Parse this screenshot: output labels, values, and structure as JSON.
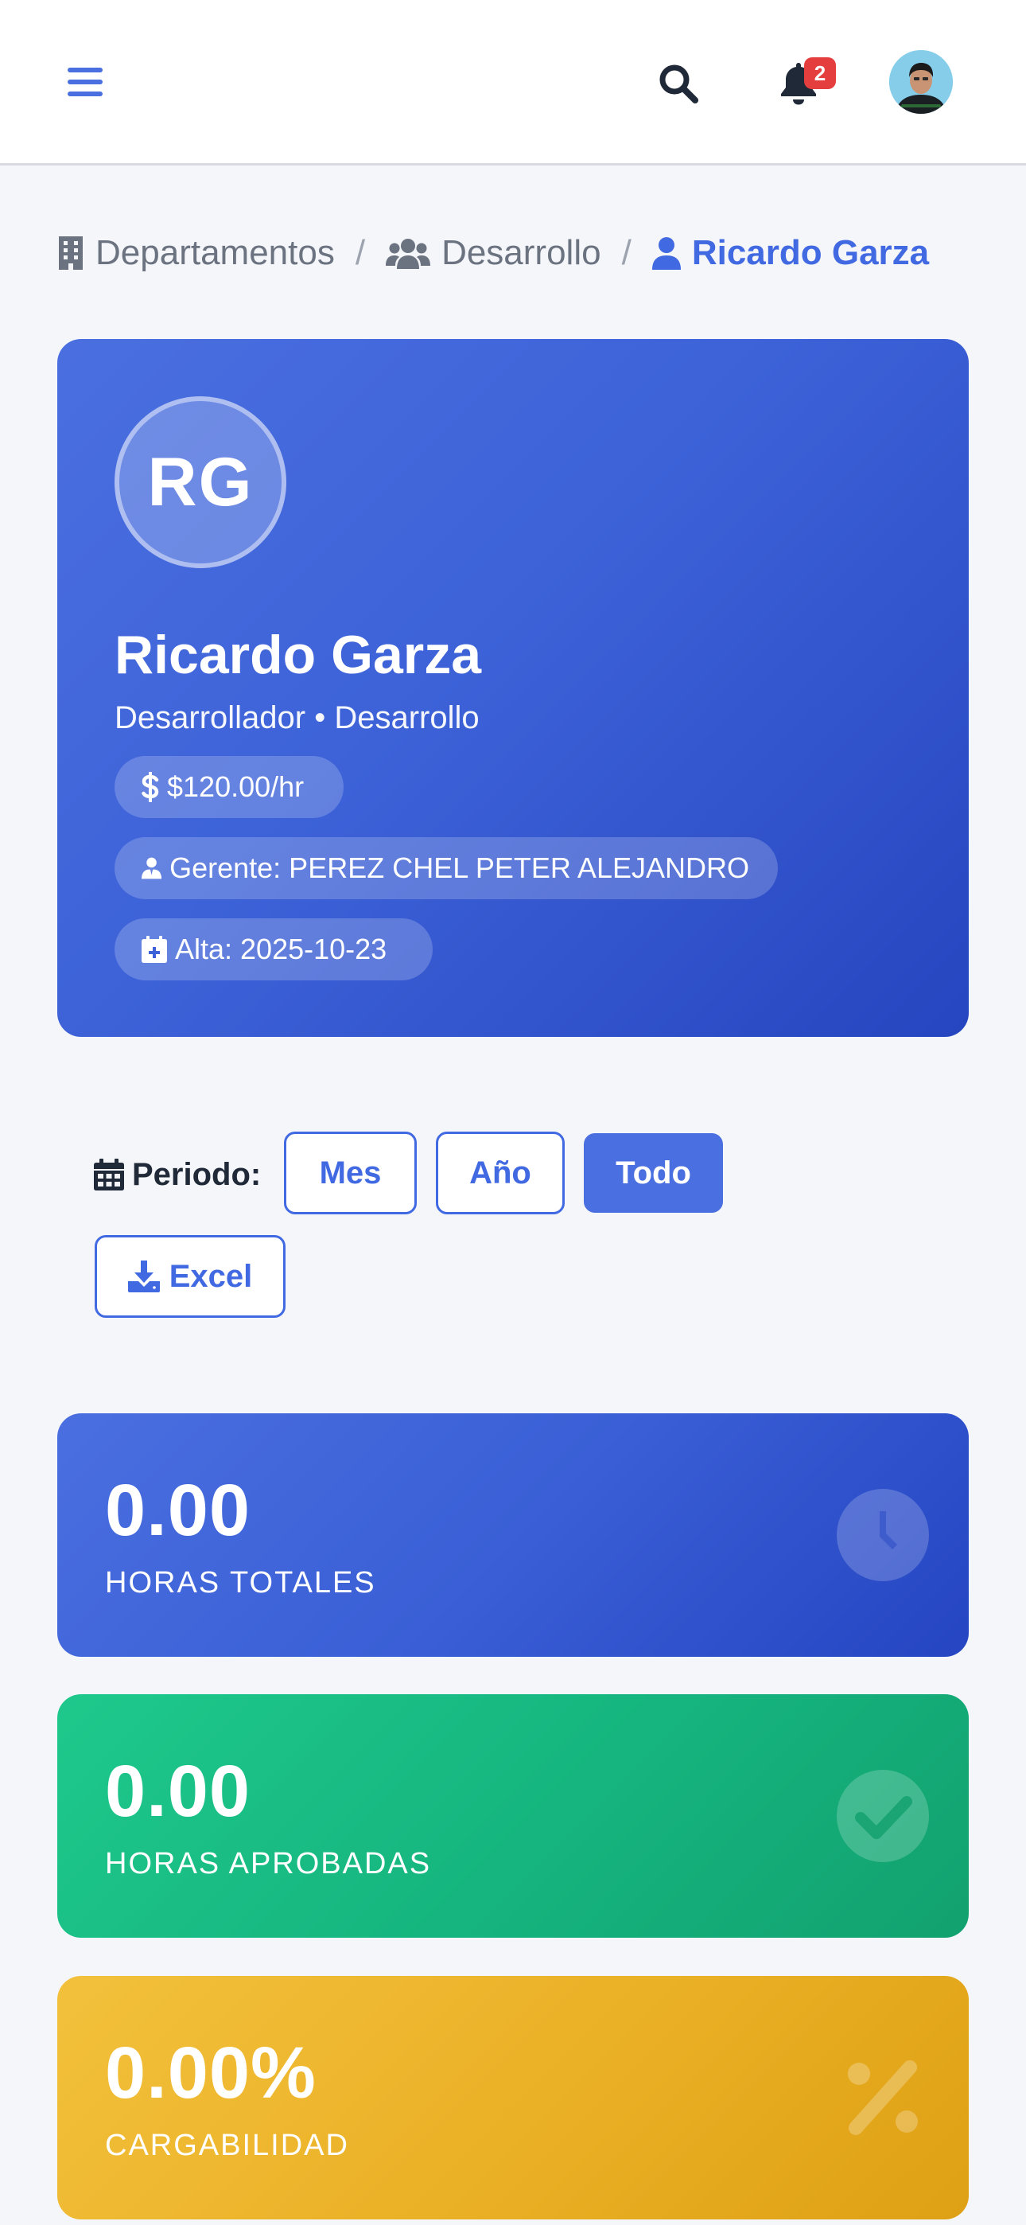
{
  "header": {
    "notifications_count": "2",
    "icons": {
      "menu": "bars-icon",
      "search": "search-icon",
      "notifications": "bell-icon",
      "avatar": "user-avatar"
    }
  },
  "breadcrumb": [
    {
      "label": "Departamentos",
      "icon": "building-icon"
    },
    {
      "label": "Desarrollo",
      "icon": "users-icon"
    },
    {
      "label": "Ricardo Garza",
      "icon": "user-icon"
    }
  ],
  "breadcrumb_separator": "/",
  "profile": {
    "initials": "RG",
    "name": "Ricardo Garza",
    "role_line": "Desarrollador • Desarrollo",
    "rate": "$120.00/hr",
    "manager": "Gerente: PEREZ CHEL PETER ALEJANDRO",
    "hire_date": "Alta: 2025-10-23"
  },
  "period": {
    "label": "Periodo:",
    "options": [
      "Mes",
      "Año",
      "Todo"
    ],
    "selected": "Todo",
    "export_label": "Excel"
  },
  "stats": [
    {
      "value": "0.00",
      "label": "HORAS TOTALES",
      "icon": "clock-icon",
      "color": "#4a6fe0"
    },
    {
      "value": "0.00",
      "label": "HORAS APROBADAS",
      "icon": "check-circle-icon",
      "color": "#1ec98c"
    },
    {
      "value": "0.00%",
      "label": "CARGABILIDAD",
      "icon": "percent-icon",
      "color": "#f3c13c"
    }
  ],
  "colors": {
    "accent": "#4169e1",
    "badge": "#e53e3e",
    "background": "#f5f6fa"
  }
}
